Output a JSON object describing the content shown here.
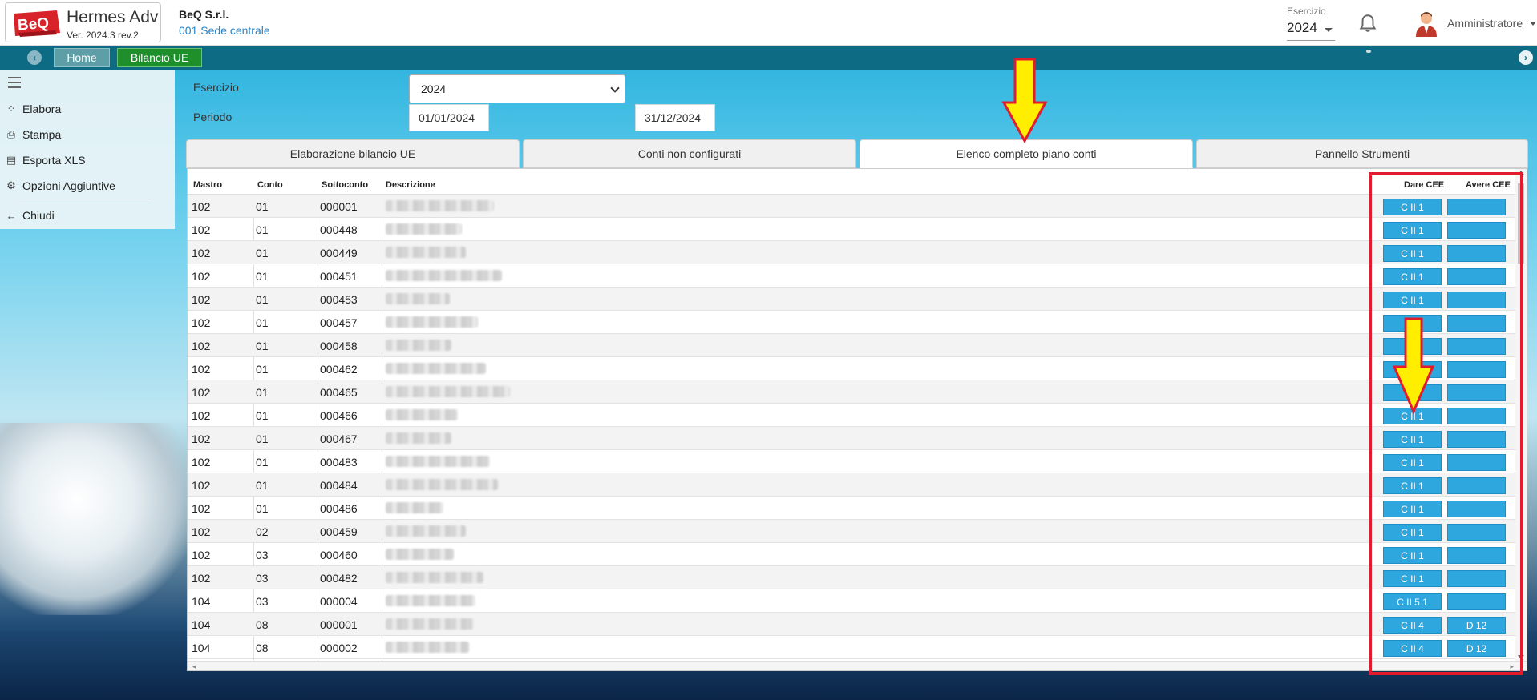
{
  "header": {
    "app_name": "Hermes Adv",
    "app_version": "Ver. 2024.3 rev.2",
    "logo_text": "BeQ",
    "company": "BeQ S.r.l.",
    "branch": "001 Sede centrale",
    "esercizio_label": "Esercizio",
    "esercizio_value": "2024",
    "user": "Amministratore"
  },
  "tabs": {
    "home": "Home",
    "bilancio": "Bilancio UE"
  },
  "sidebar": {
    "items": [
      {
        "label": "Elabora",
        "icon": "spinner-icon"
      },
      {
        "label": "Stampa",
        "icon": "printer-icon"
      },
      {
        "label": "Esporta XLS",
        "icon": "file-icon"
      },
      {
        "label": "Opzioni Aggiuntive",
        "icon": "gears-icon"
      },
      {
        "label": "Chiudi",
        "icon": "arrow-left-icon"
      }
    ]
  },
  "form": {
    "esercizio_label": "Esercizio",
    "esercizio_value": "2024",
    "periodo_label": "Periodo",
    "date_from": "01/01/2024",
    "date_to": "31/12/2024"
  },
  "content_tabs": [
    "Elaborazione bilancio UE",
    "Conti non configurati",
    "Elenco completo piano conti",
    "Pannello Strumenti"
  ],
  "grid": {
    "columns": [
      "Mastro",
      "Conto",
      "Sottoconto",
      "Descrizione",
      "Dare CEE",
      "Avere CEE"
    ],
    "rows": [
      {
        "mastro": "102",
        "conto": "01",
        "sottoconto": "000001",
        "dare": "C II 1",
        "avere": ""
      },
      {
        "mastro": "102",
        "conto": "01",
        "sottoconto": "000448",
        "dare": "C II 1",
        "avere": ""
      },
      {
        "mastro": "102",
        "conto": "01",
        "sottoconto": "000449",
        "dare": "C II 1",
        "avere": ""
      },
      {
        "mastro": "102",
        "conto": "01",
        "sottoconto": "000451",
        "dare": "C II 1",
        "avere": ""
      },
      {
        "mastro": "102",
        "conto": "01",
        "sottoconto": "000453",
        "dare": "C II 1",
        "avere": ""
      },
      {
        "mastro": "102",
        "conto": "01",
        "sottoconto": "000457",
        "dare": "",
        "avere": ""
      },
      {
        "mastro": "102",
        "conto": "01",
        "sottoconto": "000458",
        "dare": "",
        "avere": ""
      },
      {
        "mastro": "102",
        "conto": "01",
        "sottoconto": "000462",
        "dare": "",
        "avere": ""
      },
      {
        "mastro": "102",
        "conto": "01",
        "sottoconto": "000465",
        "dare": "",
        "avere": ""
      },
      {
        "mastro": "102",
        "conto": "01",
        "sottoconto": "000466",
        "dare": "C II 1",
        "avere": ""
      },
      {
        "mastro": "102",
        "conto": "01",
        "sottoconto": "000467",
        "dare": "C II 1",
        "avere": ""
      },
      {
        "mastro": "102",
        "conto": "01",
        "sottoconto": "000483",
        "dare": "C II 1",
        "avere": ""
      },
      {
        "mastro": "102",
        "conto": "01",
        "sottoconto": "000484",
        "dare": "C II 1",
        "avere": ""
      },
      {
        "mastro": "102",
        "conto": "01",
        "sottoconto": "000486",
        "dare": "C II 1",
        "avere": ""
      },
      {
        "mastro": "102",
        "conto": "02",
        "sottoconto": "000459",
        "dare": "C II 1",
        "avere": ""
      },
      {
        "mastro": "102",
        "conto": "03",
        "sottoconto": "000460",
        "dare": "C II 1",
        "avere": ""
      },
      {
        "mastro": "102",
        "conto": "03",
        "sottoconto": "000482",
        "dare": "C II 1",
        "avere": ""
      },
      {
        "mastro": "104",
        "conto": "03",
        "sottoconto": "000004",
        "dare": "C II 5 1",
        "avere": ""
      },
      {
        "mastro": "104",
        "conto": "08",
        "sottoconto": "000001",
        "dare": "C II 4",
        "avere": "D 12"
      },
      {
        "mastro": "104",
        "conto": "08",
        "sottoconto": "000002",
        "dare": "C II 4",
        "avere": "D 12"
      }
    ]
  },
  "colors": {
    "tabstrip": "#0d6b84",
    "home_tab": "#5e9fa7",
    "bilancio_tab": "#1f8f2c",
    "cee_button": "#2ea7de",
    "highlight_red": "#e21b2e",
    "arrow_yellow": "#ffee00"
  }
}
